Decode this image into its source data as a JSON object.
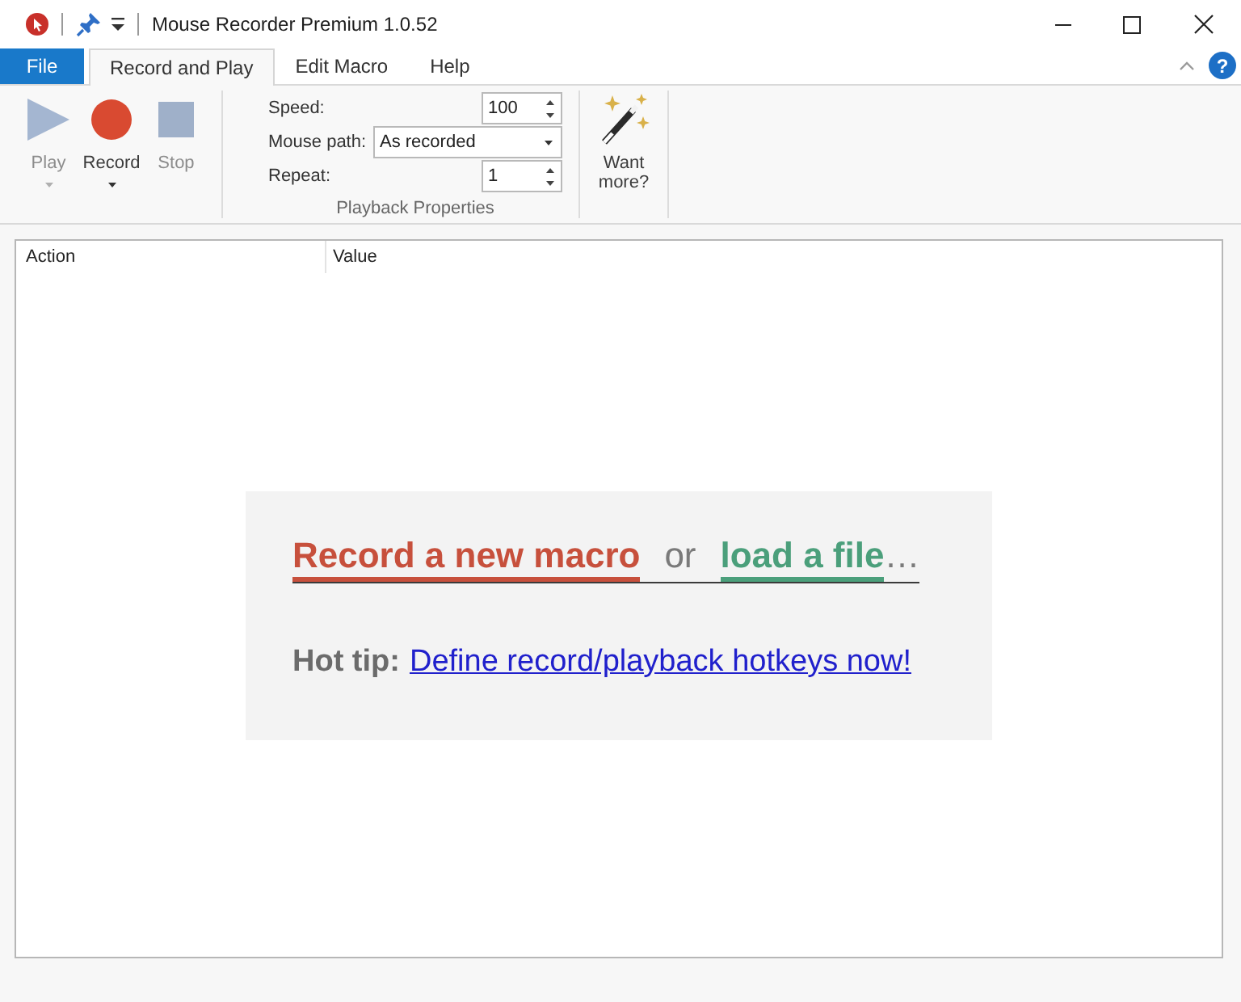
{
  "window": {
    "title": "Mouse Recorder Premium 1.0.52"
  },
  "help_button": {
    "label": "?"
  },
  "tabs": [
    {
      "label": "File",
      "kind": "backstage",
      "selected": false
    },
    {
      "label": "Record and Play",
      "kind": "tab",
      "selected": true
    },
    {
      "label": "Edit Macro",
      "kind": "tab",
      "selected": false
    },
    {
      "label": "Help",
      "kind": "tab",
      "selected": false
    }
  ],
  "ribbon": {
    "buttons": [
      {
        "kind": "play",
        "label": "Play",
        "disabled": true,
        "has_menu": true
      },
      {
        "kind": "record",
        "label": "Record",
        "disabled": false,
        "has_menu": true
      },
      {
        "kind": "stop",
        "label": "Stop",
        "disabled": true,
        "has_menu": false
      }
    ],
    "playback_properties": {
      "title": "Playback Properties",
      "fields": [
        {
          "kind": "spinner",
          "label": "Speed:",
          "value": "100"
        },
        {
          "kind": "dropdown",
          "label": "Mouse path:",
          "value": "As recorded"
        },
        {
          "kind": "spinner",
          "label": "Repeat:",
          "value": "1"
        }
      ]
    },
    "extras": [
      {
        "kind": "wand",
        "label": "Want more?"
      }
    ]
  },
  "table": {
    "columns": [
      "Action",
      "Value"
    ]
  },
  "start_panel": {
    "record_link": "Record a new macro",
    "connector": "or",
    "load_link": "load a file",
    "ellipsis": "…",
    "tip_label": "Hot tip:",
    "tip_link": "Define record/playback hotkeys now!"
  }
}
